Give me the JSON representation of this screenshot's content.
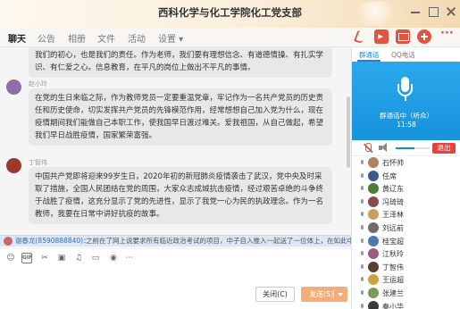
{
  "window": {
    "title": "西科化学与化工学院化工党支部"
  },
  "tabs": [
    {
      "label": "聊天",
      "active": true
    },
    {
      "label": "公告",
      "active": false
    },
    {
      "label": "相册",
      "active": false
    },
    {
      "label": "文件",
      "active": false
    },
    {
      "label": "活动",
      "active": false
    },
    {
      "label": "设置 ▾",
      "active": false
    }
  ],
  "header_icons": [
    "phone-icon",
    "video-icon",
    "screen-share-icon",
    "add-icon",
    "more-icon"
  ],
  "messages": [
    {
      "sender": "",
      "text": "我们的初心，也是我们的责任。作为老师，我们要有理想信念、有道德情操、有扎实学识、有仁爱之心。信息教育，在平凡的岗位上做出不平凡的事情。",
      "avatar_color": "#c8c8c8"
    },
    {
      "sender": "赵小玲",
      "text": "在党的生日来临之际，作为教师党员一定要重温党章，牢记作为一名共产党员的历史责任和历史使命，切实发挥共产党员的先锋模范作用，经常想想自己加入党为什么，现在疫情期间我们能做自己本职工作，使我国早日渡过难关。爱我祖国，从自己做起，希望我们早日战胜疫情，国家繁荣富强。",
      "avatar_color": "#8a6fa8"
    },
    {
      "sender": "丁智伟",
      "text": "中国共产党即将迎来99岁生日，2020年初的新冠肺炎疫情袭击了武汉，党中央及时采取了措施，全国人民团结在党的周围，大家众志成城抗击疫情，经过艰苦卓绝的斗争终于战胜了疫情，这充分显示了党的先进性，显示了我党一心为民的执政理念。作为一名教师，我要在日常中讲好抗疫的故事。",
      "avatar_color": "#9b3a2a"
    }
  ],
  "notice": {
    "who": "谢春龙(8590888840)：",
    "text": "之前在了网上说要求所有临近政治考试的项目，中子自入推入一起送了一位体上，在如此中以各"
  },
  "composer": {
    "tools": [
      "emoji-icon",
      "gif-icon",
      "scissors-icon",
      "image-icon",
      "music-icon",
      "folder-icon",
      "voice-icon",
      "more-tools-icon"
    ],
    "close_label": "关闭(C)",
    "send_label": "发送(S)"
  },
  "side_tabs": [
    {
      "label": "群通话",
      "active": true
    },
    {
      "label": "QQ电话",
      "active": false
    }
  ],
  "voice": {
    "status": "群通话中（听众）",
    "duration": "11:58",
    "volume": 0.55
  },
  "exit_label": "退出",
  "members": [
    {
      "name": "石怀帅",
      "color": "#b08060"
    },
    {
      "name": "任席",
      "color": "#3a5a8a"
    },
    {
      "name": "黄辽东",
      "color": "#4c7b3a"
    },
    {
      "name": "冯琦琦",
      "color": "#8a4a4a"
    },
    {
      "name": "王泽林",
      "color": "#c6a25a"
    },
    {
      "name": "刘远前",
      "color": "#6b6b6b"
    },
    {
      "name": "桂宝超",
      "color": "#4a78b0"
    },
    {
      "name": "江秋玲",
      "color": "#9c5b7d"
    },
    {
      "name": "丁智伟",
      "color": "#5a3f2e"
    },
    {
      "name": "王运超",
      "color": "#d0a040"
    },
    {
      "name": "张建兰",
      "color": "#7a9c5a"
    },
    {
      "name": "秦小华",
      "color": "#3a3a3a"
    }
  ]
}
